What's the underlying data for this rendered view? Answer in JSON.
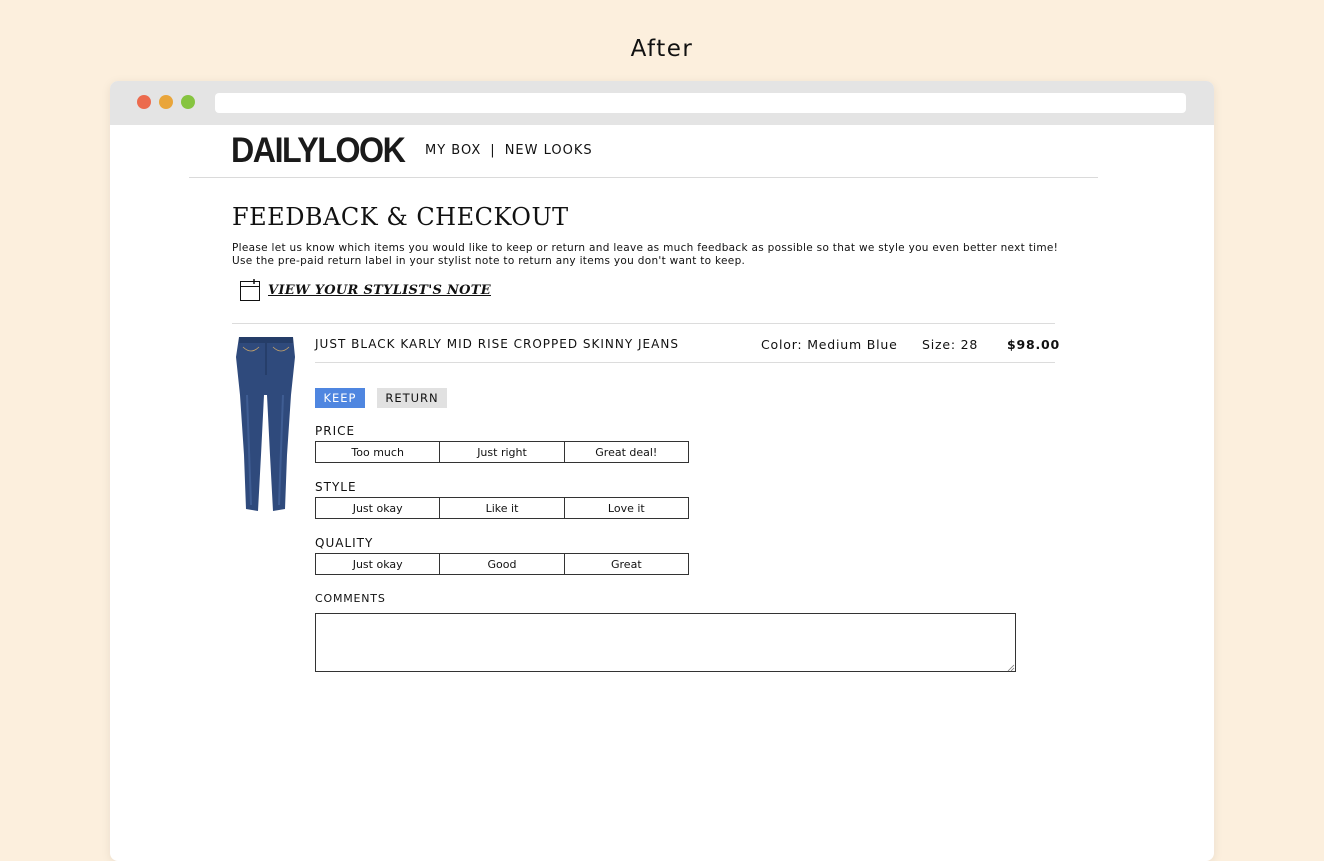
{
  "caption": "After",
  "logo": "DAILYLOOK",
  "nav": {
    "my_box": "MY BOX",
    "separator": "|",
    "new_looks": "NEW LOOKS"
  },
  "page_title": "FEEDBACK & CHECKOUT",
  "intro": "Please let us know which items you would like to keep or return and leave as much feedback as possible so that we style you even better next time! Use the pre-paid return label in your stylist note to return any items you don't want to keep.",
  "stylist_note_link": "VIEW YOUR STYLIST'S NOTE",
  "item": {
    "name": "JUST BLACK KARLY MID RISE CROPPED SKINNY JEANS",
    "color": "Color: Medium Blue",
    "size": "Size: 28",
    "price": "$98.00"
  },
  "actions": {
    "keep": "KEEP",
    "return": "RETURN",
    "selected": "KEEP"
  },
  "feedback": {
    "price": {
      "label": "PRICE",
      "options": [
        "Too much",
        "Just right",
        "Great deal!"
      ]
    },
    "style": {
      "label": "STYLE",
      "options": [
        "Just okay",
        "Like it",
        "Love it"
      ]
    },
    "quality": {
      "label": "QUALITY",
      "options": [
        "Just okay",
        "Good",
        "Great"
      ]
    }
  },
  "comments": {
    "label": "COMMENTS",
    "value": ""
  },
  "colors": {
    "background": "#fcefdd",
    "keep_active": "#4f86e0",
    "return_inactive": "#e1e1e1",
    "denim": "#2f4a7c"
  },
  "icons": [
    "note-icon",
    "jeans-image"
  ]
}
